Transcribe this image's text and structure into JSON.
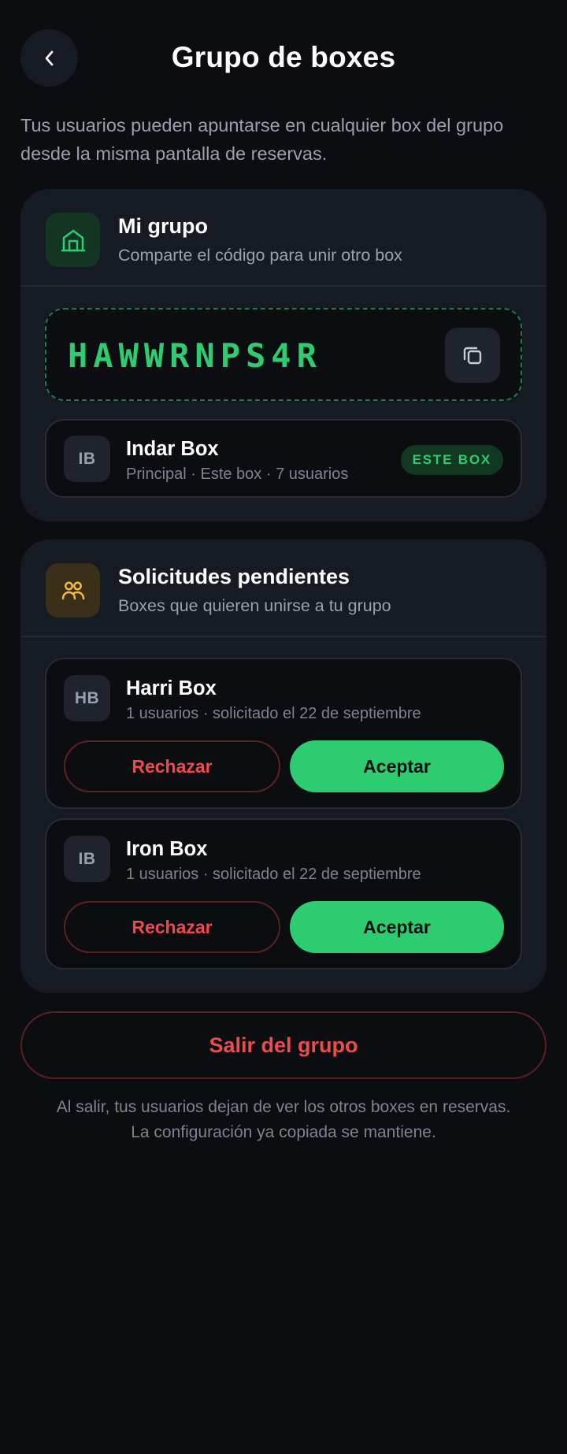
{
  "header": {
    "title": "Grupo de boxes",
    "back_icon": "chevron-left-icon"
  },
  "intro": {
    "line1": "Tus usuarios pueden apuntarse en cualquier box del grupo",
    "line2": "desde la misma pantalla de reservas."
  },
  "my_group": {
    "icon": "building-icon",
    "title": "Mi grupo",
    "subtitle": "Comparte el código para unir otro box",
    "code": "HAWWRNPS4R",
    "copy_icon": "copy-icon",
    "box": {
      "initials": "IB",
      "name": "Indar Box",
      "meta": "Principal · Este box · 7 usuarios",
      "badge": "ESTE BOX"
    }
  },
  "pending": {
    "icon": "users-icon",
    "title": "Solicitudes pendientes",
    "subtitle": "Boxes que quieren unirse a tu grupo",
    "requests": [
      {
        "initials": "HB",
        "name": "Harri Box",
        "meta": "1 usuarios · solicitado el 22 de septiembre",
        "reject_label": "Rechazar",
        "accept_label": "Aceptar"
      },
      {
        "initials": "IB",
        "name": "Iron Box",
        "meta": "1 usuarios · solicitado el 22 de septiembre",
        "reject_label": "Rechazar",
        "accept_label": "Aceptar"
      }
    ]
  },
  "leave": {
    "label": "Salir del grupo",
    "note_line1": "Al salir, tus usuarios dejan de ver los otros boxes en reservas.",
    "note_line2": "La configuración ya copiada se mantiene."
  },
  "colors": {
    "background": "#0b0d11",
    "card": "#161a22",
    "accent_green": "#2ecc71",
    "danger_red": "#ef4b4b",
    "warning_yellow": "#f2b84b"
  }
}
